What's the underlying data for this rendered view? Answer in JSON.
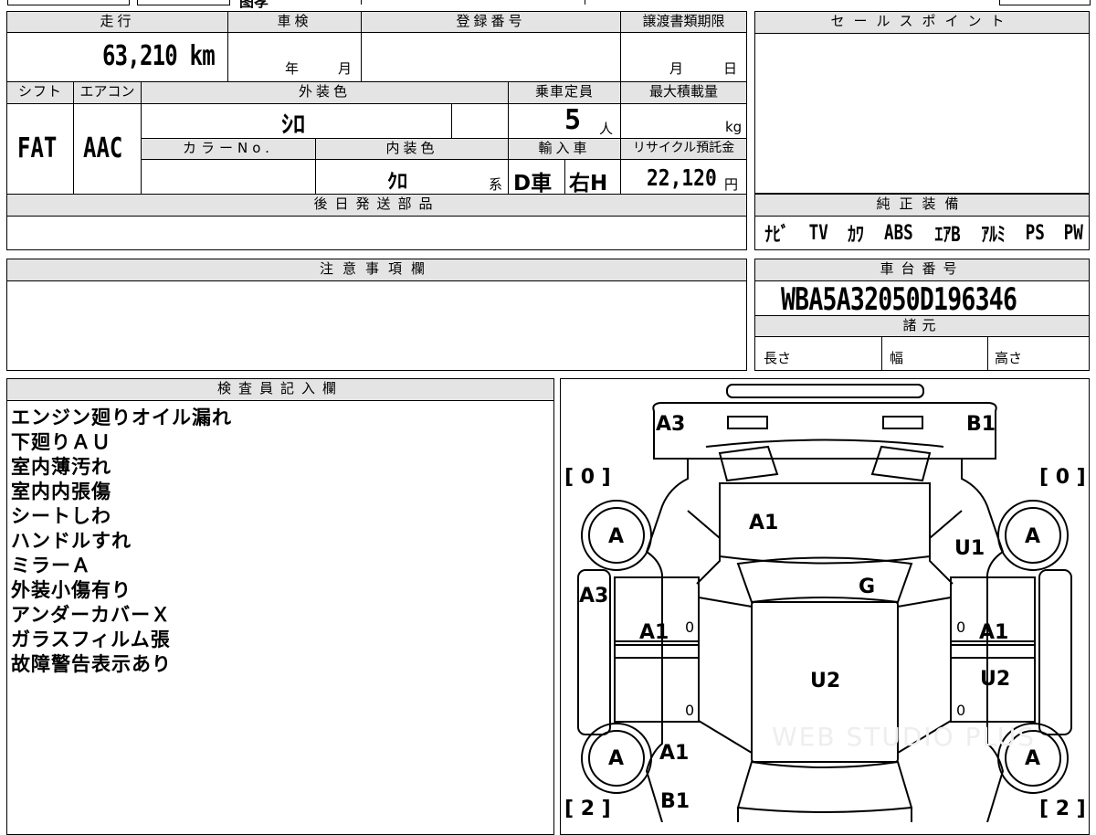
{
  "top_strip": {
    "fragment_a": "图孝",
    "fragment_b": "ﾟ"
  },
  "vehicle": {
    "mileage_label": "走行",
    "mileage": "63,210 km",
    "shaken_label": "車検",
    "shaken_year_unit": "年",
    "shaken_month_unit": "月",
    "reg_label": "登録番号",
    "transfer_label": "譲渡書類期限",
    "transfer_month_unit": "月",
    "transfer_day_unit": "日",
    "shift_label": "シフト",
    "shift": "FAT",
    "ac_label": "エアコン",
    "ac": "AAC",
    "ext_color_label": "外装色",
    "ext_color": "ｼﾛ",
    "capacity_label": "乗車定員",
    "capacity": "5",
    "capacity_unit": "人",
    "max_load_label": "最大積載量",
    "max_load_unit": "kg",
    "color_no_label": "カラーNo.",
    "int_color_label": "内装色",
    "int_color": "ｸﾛ",
    "int_color_suffix": "系",
    "import_label": "輸入車",
    "import_type": "D車",
    "handle": "右H",
    "recycle_label": "リサイクル預託金",
    "recycle_amount": "22,120",
    "recycle_unit": "円",
    "later_parts_label": "後日発送部品"
  },
  "sales_point": {
    "label": "セールスポイント"
  },
  "equipment": {
    "label": "純正装備",
    "items": [
      "ﾅﾋﾞ",
      "TV",
      "ｶﾜ",
      "ABS",
      "ｴｱB",
      "ｱﾙﾐ",
      "PS",
      "PW"
    ]
  },
  "caution": {
    "label": "注意事項欄"
  },
  "chassis": {
    "label": "車台番号",
    "number": "WBA5A32050D196346",
    "spec_label": "諸元",
    "length_label": "長さ",
    "width_label": "幅",
    "height_label": "高さ"
  },
  "inspector": {
    "label": "検査員記入欄",
    "notes": [
      "エンジン廻りオイル漏れ",
      "下廻りＡＵ",
      "室内薄汚れ",
      "室内内張傷",
      "シートしわ",
      "ハンドルすれ",
      "ミラーＡ",
      "外装小傷有り",
      "アンダーカバーＸ",
      "ガラスフィルム張",
      "故障警告表示あり"
    ]
  },
  "diagram": {
    "bracket_tl": "[ 0 ]",
    "bracket_tr": "[ 0 ]",
    "bracket_bl": "[ 2 ]",
    "bracket_br": "[ 2 ]",
    "tire_mark": "A",
    "marks": {
      "front_left_bumper": "A3",
      "front_right_bumper": "B1",
      "windshield": "A1",
      "right_fender": "U1",
      "roof": "G",
      "left_side": "A3",
      "left_front_door": "A1",
      "right_front_door": "A1",
      "floor": "U2",
      "right_rear_door": "U2",
      "left_rear_quarter": "A1",
      "rear_left": "B1"
    },
    "zeros": [
      "0",
      "0",
      "0",
      "0"
    ],
    "watermark": "WEB STUDIO PLUS"
  }
}
